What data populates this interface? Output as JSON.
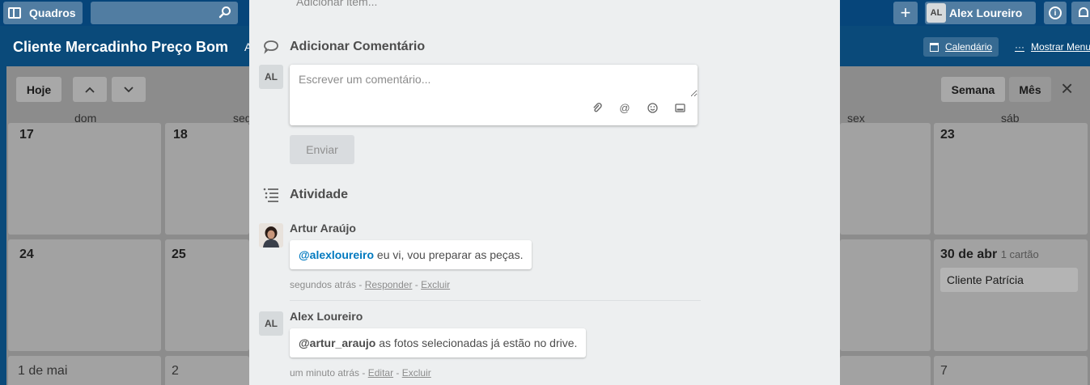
{
  "header": {
    "boards_label": "Quadros",
    "search_placeholder": "",
    "user": {
      "initials": "AL",
      "name": "Alex Loureiro"
    }
  },
  "board": {
    "title": "Cliente Mercadinho Preço Bom",
    "title_extra": "A",
    "calendar_link": "Calendário",
    "menu_link": "Mostrar Menu"
  },
  "calendar": {
    "today_label": "Hoje",
    "week_label": "Semana",
    "month_label": "Mês",
    "weekdays": {
      "dom": "dom",
      "seg": "seg",
      "sex": "sex",
      "sab": "sáb"
    },
    "days": {
      "d17": "17",
      "d18": "18",
      "d23": "23",
      "d24": "24",
      "d25": "25",
      "d30": "30 de abr",
      "d30_count": "1 cartão",
      "may1": "1 de mai",
      "may2": "2",
      "may7": "7"
    },
    "card_title": "Cliente Patrícia"
  },
  "modal": {
    "add_item_placeholder": "Adicionar item...",
    "comment_section_title": "Adicionar Comentário",
    "comment_avatar": "AL",
    "comment_placeholder": "Escrever um comentário...",
    "send_label": "Enviar",
    "activity_title": "Atividade",
    "activities": [
      {
        "author": "Artur Araújo",
        "mention": "@alexloureiro",
        "text": " eu vi, vou preparar as peças.",
        "time": "segundos atrás",
        "sep1": " - ",
        "action1": "Responder",
        "sep2": " - ",
        "action2": "Excluir"
      },
      {
        "avatar": "AL",
        "author": "Alex Loureiro",
        "mention": "@artur_araujo",
        "text": " as fotos selecionadas já estão no drive.",
        "time": "um minuto atrás",
        "sep1": " - ",
        "action1": "Editar",
        "sep2": " - ",
        "action2": "Excluir"
      }
    ]
  },
  "colors": {
    "header_blue": "#06457a",
    "mention_blue": "#0079bf",
    "modal_bg": "#edeff0"
  }
}
